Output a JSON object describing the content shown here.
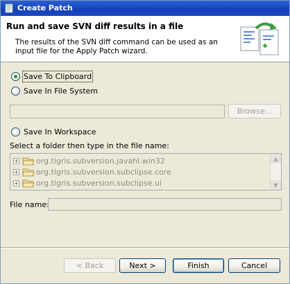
{
  "window": {
    "title": "Create Patch"
  },
  "banner": {
    "heading": "Run and save SVN diff results in a file",
    "description": "The results of the SVN diff command can be used as an input file for the Apply Patch wizard."
  },
  "options": {
    "clipboard": {
      "label": "Save To Clipboard",
      "checked": true
    },
    "filesystem": {
      "label": "Save In File System",
      "checked": false
    },
    "workspace": {
      "label": "Save In Workspace",
      "checked": false
    }
  },
  "filesystem": {
    "path_value": "",
    "browse_label": "Browse..."
  },
  "workspace": {
    "folder_prompt": "Select a folder then type in the file name:",
    "tree_items": [
      {
        "label": "org.tigris.subversion.javahl.win32"
      },
      {
        "label": "org.tigris.subversion.subclipse.core"
      },
      {
        "label": "org.tigris.subversion.subclipse.ui"
      }
    ],
    "file_name_label": "File name:",
    "file_name_value": ""
  },
  "buttons": {
    "back": "< Back",
    "next": "Next >",
    "finish": "Finish",
    "cancel": "Cancel"
  },
  "colors": {
    "titlebar": "#1541b8",
    "accent_radio": "#21a121",
    "disabled_text": "#8e8c84"
  }
}
